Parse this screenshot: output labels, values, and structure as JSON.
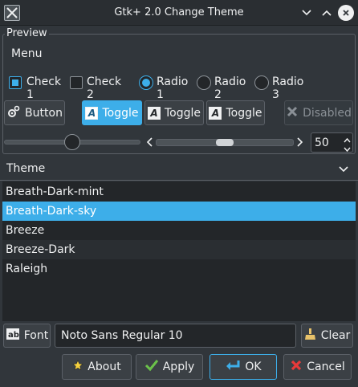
{
  "window": {
    "title": "Gtk+ 2.0 Change Theme"
  },
  "preview": {
    "label": "Preview",
    "menu_label": "Menu",
    "checks": [
      {
        "label": "Check 1",
        "checked": true
      },
      {
        "label": "Check 2",
        "checked": false
      }
    ],
    "radios": [
      {
        "label": "Radio 1",
        "selected": true
      },
      {
        "label": "Radio 2",
        "selected": false
      },
      {
        "label": "Radio 3",
        "selected": false
      }
    ],
    "buttons": {
      "button_label": "Button",
      "toggles": [
        {
          "label": "Toggle",
          "active": true
        },
        {
          "label": "Toggle",
          "active": false
        },
        {
          "label": "Toggle",
          "active": false
        }
      ],
      "disabled_label": "Disabled"
    },
    "slider_value_fraction": 0.5,
    "scrollbar_position_fraction": 0.5,
    "spin_value": "50"
  },
  "theme": {
    "header": "Theme",
    "items": [
      "Breath-Dark-mint",
      "Breath-Dark-sky",
      "Breeze",
      "Breeze-Dark",
      "Raleigh"
    ],
    "selected_index": 1
  },
  "font": {
    "button_label": "Font",
    "value": "Noto Sans Regular 10",
    "clear_label": "Clear"
  },
  "actions": {
    "about": "About",
    "apply": "Apply",
    "ok": "OK",
    "cancel": "Cancel"
  },
  "colors": {
    "accent": "#3daee9",
    "background": "#31363b",
    "cancel_red": "#e83a3a",
    "apply_green": "#6bc24a",
    "about_star": "#f4d03f"
  }
}
